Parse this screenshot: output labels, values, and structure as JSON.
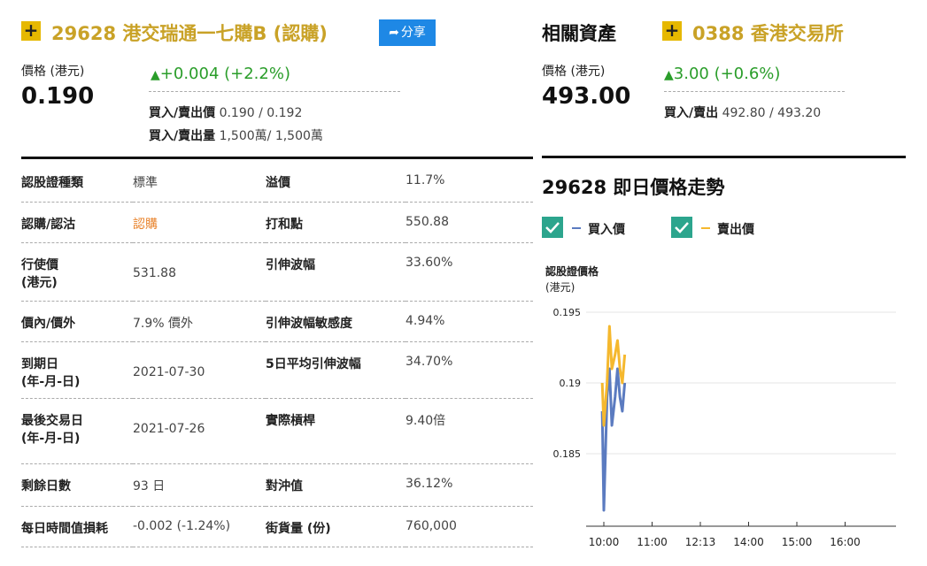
{
  "warrant": {
    "plus": "+",
    "title": "29628 港交瑞通一七購B (認購)",
    "share_label": "分享",
    "price_label": "價格 (港元)",
    "price": "0.190",
    "change": "+0.004 (+2.2%)",
    "bid_ask_price_label": "買入/賣出價",
    "bid_ask_price": "0.190 / 0.192",
    "bid_ask_vol_label": "買入/賣出量",
    "bid_ask_vol": "1,500萬/ 1,500萬"
  },
  "related": {
    "title": "相關資產",
    "plus": "+",
    "name": "0388 香港交易所",
    "price_label": "價格 (港元)",
    "price": "493.00",
    "change": "3.00 (+0.6%)",
    "bid_ask_label": "買入/賣出",
    "bid_ask": "492.80 / 493.20"
  },
  "details": {
    "rows": [
      {
        "k1": "認股證種類",
        "v1": "標準",
        "k2": "溢價",
        "v2": "11.7%"
      },
      {
        "k1": "認購/認沽",
        "v1": "認購",
        "k2": "打和點",
        "v2": "550.88"
      },
      {
        "k1": "行使價\n(港元)",
        "v1": "531.88",
        "k2": "引伸波幅",
        "v2": "33.60%"
      },
      {
        "k1": "價內/價外",
        "v1": "7.9% 價外",
        "k2": "引伸波幅敏感度",
        "v2": "4.94%"
      },
      {
        "k1": "到期日\n(年-月-日)",
        "v1": "2021-07-30",
        "k2": "5日平均引伸波幅",
        "v2": "34.70%"
      },
      {
        "k1": "最後交易日\n(年-月-日)",
        "v1": "2021-07-26",
        "k2": "實際槓桿",
        "v2": "9.40倍"
      },
      {
        "k1": "剩餘日數",
        "v1": "93 日",
        "k2": "對沖值",
        "v2": "36.12%"
      },
      {
        "k1": "每日時間值損耗",
        "v1": "-0.002 (-1.24%)",
        "k2": "街貨量 (份)",
        "v2": "760,000"
      }
    ]
  },
  "intraday": {
    "title": "29628 即日價格走勢",
    "legend_bid": "買入價",
    "legend_ask": "賣出價",
    "ylabel_line1": "認股證價格",
    "ylabel_line2": "(港元)"
  },
  "colors": {
    "bid": "#5b7bc0",
    "ask": "#f5b82e",
    "up": "#2a9d2a",
    "accent": "#e6b800",
    "check": "#2ca58d"
  },
  "chart_data": {
    "type": "line",
    "x_ticks": [
      "10:00",
      "11:00",
      "12:13",
      "14:00",
      "15:00",
      "16:00"
    ],
    "y_ticks": [
      0.195,
      0.19,
      0.185
    ],
    "ylim": [
      0.1805,
      0.1955
    ],
    "series": [
      {
        "name": "買入價",
        "color": "#5b7bc0",
        "x": [
          "09:58",
          "10:00",
          "10:04",
          "10:07",
          "10:10",
          "10:14",
          "10:17",
          "10:20",
          "10:23",
          "10:26"
        ],
        "values": [
          0.188,
          0.181,
          0.189,
          0.191,
          0.187,
          0.189,
          0.191,
          0.189,
          0.188,
          0.19
        ]
      },
      {
        "name": "賣出價",
        "color": "#f5b82e",
        "x": [
          "09:58",
          "10:00",
          "10:04",
          "10:07",
          "10:10",
          "10:14",
          "10:17",
          "10:20",
          "10:23",
          "10:26"
        ],
        "values": [
          0.19,
          0.187,
          0.19,
          0.194,
          0.191,
          0.192,
          0.193,
          0.191,
          0.19,
          0.192
        ]
      }
    ]
  }
}
